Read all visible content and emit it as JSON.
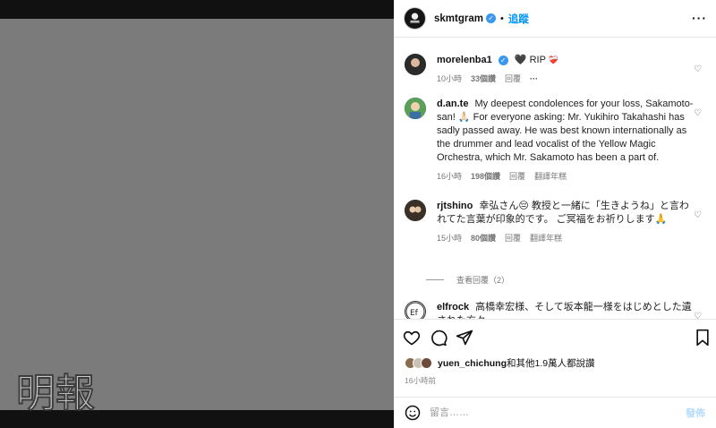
{
  "colors": {
    "accent": "#0095f6",
    "verified": "#3897f0",
    "media_bg": "#7b7b7b"
  },
  "header": {
    "username": "skmtgram",
    "follow_label": "追蹤",
    "more_icon": "ellipsis-icon"
  },
  "comments": [
    {
      "user": "morelenba1",
      "verified": true,
      "text": "🖤 RIP",
      "extra": "❤️‍🩹",
      "time": "10小時",
      "likes": "33個讚",
      "reply": "回覆",
      "more": "···"
    },
    {
      "user": "d.an.te",
      "text": "My deepest condolences for your loss, Sakamoto-san! 🙏🏻 For everyone asking: Mr. Yukihiro Takahashi has sadly passed away. He was best known internationally as the drummer and lead vocalist of the Yellow Magic Orchestra, which Mr. Sakamoto has been a part of.",
      "time": "16小時",
      "likes": "198個讚",
      "reply": "回覆",
      "translate": "翻譯年糕"
    },
    {
      "user": "rjtshino",
      "text": "幸弘さん😔 教授と一緒に「生きようね」と言われてた言葉が印象的です。 ご冥福をお祈りします🙏",
      "time": "15小時",
      "likes": "80個讚",
      "reply": "回覆",
      "translate": "翻譯年糕",
      "view_replies": "查看回覆（2）"
    },
    {
      "user": "elfrock",
      "text": "高橋幸宏様、そして坂本龍一様をはじめとした遺された方々"
    }
  ],
  "likes_summary": {
    "user": "yuen_chichung",
    "rest": "和其他1.9萬人都說讚"
  },
  "post_time": "16小時前",
  "composer": {
    "placeholder": "留言……",
    "post_label": "發佈"
  },
  "watermark": "明報"
}
